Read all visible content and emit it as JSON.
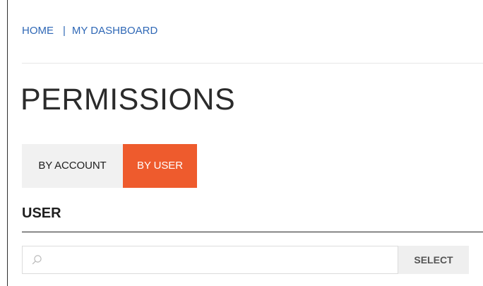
{
  "breadcrumb": {
    "home": "HOME",
    "separator": "|",
    "dashboard": "MY DASHBOARD"
  },
  "page": {
    "title": "PERMISSIONS"
  },
  "tabs": [
    {
      "label": "BY ACCOUNT",
      "active": false
    },
    {
      "label": "BY USER",
      "active": true
    }
  ],
  "user_section": {
    "title": "USER",
    "search": {
      "placeholder": "",
      "value": "",
      "icon": "search-icon"
    },
    "select_label": "SELECT"
  },
  "colors": {
    "link": "#2f68b6",
    "tab_active": "#ee5b2d",
    "tab_inactive": "#f1f1f1",
    "text_dark": "#2b2b2b",
    "button_bg": "#efefef"
  }
}
